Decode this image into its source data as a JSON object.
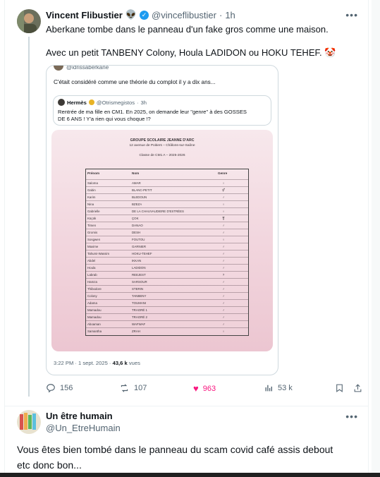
{
  "post": {
    "author_name": "Vincent Flibustier",
    "author_emoji": "👽",
    "handle": "@vinceflibustier",
    "time": "1h",
    "text_line1": "Aberkane tombe dans le panneau d'un fake gros comme une maison.",
    "text_line2": "Avec un petit TANBENY Colony, Houla LADIDON ou HOKU TEHEF. 🤡"
  },
  "quote": {
    "handle": "@idrissaberkane",
    "text": "C'était considéré comme une théorie du complot il y a dix ans...",
    "inner_name": "Hermès",
    "inner_handle": "@Otrismegistos",
    "inner_time": "3h",
    "inner_text1": "Rentrée de ma fille en CM1. En 2025, on demande leur \"genre\" à des GOSSES",
    "inner_text2": "DE 6 ANS ! Y'a rien qui vous choque !?",
    "timestamp": "3:22 PM · 1 sept. 2025 ·",
    "views_count": "43,6 k",
    "views_label": "vues"
  },
  "document": {
    "title": "GROUPE SCOLAIRE JEANNE D'ARC",
    "address": "12 avenue de Poitiers – Châlons-sur-Saône",
    "class_line": "Classe de CM1 A – 2025-2026",
    "col_firstname": "Prénom",
    "col_lastname": "Nom",
    "col_gender": "Genre",
    "rows": [
      {
        "first": "Saloma",
        "last": "AMAR",
        "g": "♀"
      },
      {
        "first": "Gabin",
        "last": "BLANC-PETIT",
        "g": "⚥"
      },
      {
        "first": "Karim",
        "last": "BLEDOUN",
        "g": "♂"
      },
      {
        "first": "Nina",
        "last": "BZEZA",
        "g": "♀"
      },
      {
        "first": "Gabrielle",
        "last": "DE LA CHAUVAUDIERE D'ESTRÉES",
        "g": "♀"
      },
      {
        "first": "Küçük",
        "last": "ÇOK",
        "g": "⚧"
      },
      {
        "first": "Timen",
        "last": "DANAO",
        "g": "♂"
      },
      {
        "first": "Gromis",
        "last": "DESH",
        "g": "♂"
      },
      {
        "first": "Sosgwen",
        "last": "FOUTOU",
        "g": "♀"
      },
      {
        "first": "Maxime",
        "last": "GARNIER",
        "g": "♂"
      },
      {
        "first": "Tahumi-Wassim",
        "last": "HOKU-TEHEF",
        "g": "♂"
      },
      {
        "first": "Abdel",
        "last": "IKKAN",
        "g": "♂"
      },
      {
        "first": "Houla",
        "last": "LADIDON",
        "g": "♂"
      },
      {
        "first": "Labrab",
        "last": "REEJEST",
        "g": "?"
      },
      {
        "first": "Hamza",
        "last": "SARSOUR",
        "g": "♂"
      },
      {
        "first": "Thibodore",
        "last": "STERIN",
        "g": "♂"
      },
      {
        "first": "Colony",
        "last": "TANBENY",
        "g": "♂"
      },
      {
        "first": "Adama",
        "last": "TOUMANI",
        "g": "♂"
      },
      {
        "first": "Mamadou",
        "last": "TRAORÉ 1",
        "g": "♂"
      },
      {
        "first": "Mamadou",
        "last": "TRAORÉ 2",
        "g": "♂"
      },
      {
        "first": "Aboaman",
        "last": "WAFWAF",
        "g": "♂"
      },
      {
        "first": "Samantha",
        "last": "ZRAH",
        "g": "♀"
      }
    ]
  },
  "actions": {
    "replies": "156",
    "reposts": "107",
    "likes": "963",
    "views": "53 k",
    "like_color": "#f91880"
  },
  "reply": {
    "author_name": "Un être humain",
    "handle": "@Un_EtreHumain",
    "text_line1": "Vous êtes bien tombé dans le panneau du scam covid café assis debout",
    "text_line2": "etc donc bon..."
  },
  "colors": {
    "accent": "#1d9bf0",
    "muted": "#536471",
    "border": "#cfd9de"
  }
}
